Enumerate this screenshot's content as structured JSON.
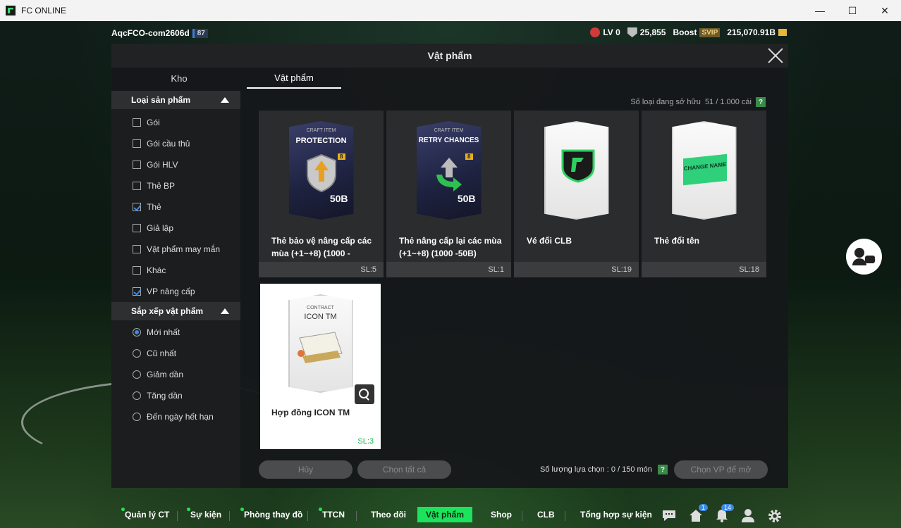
{
  "window": {
    "title": "FC ONLINE",
    "minimize": "—",
    "maximize": "☐",
    "close": "✕"
  },
  "hud": {
    "username": "AqcFCO-com2606d",
    "level": "87",
    "lv": "LV 0",
    "points": "25,855",
    "boost_label": "Boost",
    "svip": "SVIP",
    "balance": "215,070.91B"
  },
  "dialog": {
    "title": "Vật phẩm",
    "tabs": [
      "Kho",
      "Vật phẩm"
    ],
    "owned_label": "Số loại đang sở hữu",
    "owned_value": "51 / 1.000 cái",
    "help": "?",
    "product_section": "Loại sản phẩm",
    "product_types": [
      {
        "label": "Gói",
        "checked": false
      },
      {
        "label": "Gói cầu thủ",
        "checked": false
      },
      {
        "label": "Gói HLV",
        "checked": false
      },
      {
        "label": "Thẻ BP",
        "checked": false
      },
      {
        "label": "Thẻ",
        "checked": true
      },
      {
        "label": "Giả lập",
        "checked": false
      },
      {
        "label": "Vật phẩm may mắn",
        "checked": false
      },
      {
        "label": "Khác",
        "checked": false
      },
      {
        "label": "VP nâng cấp",
        "checked": true
      }
    ],
    "sort_section": "Sắp xếp vật phẩm",
    "sort_options": [
      {
        "label": "Mới nhất",
        "selected": true
      },
      {
        "label": "Cũ nhất",
        "selected": false
      },
      {
        "label": "Giảm dần",
        "selected": false
      },
      {
        "label": "Tăng dần",
        "selected": false
      },
      {
        "label": "Đến ngày hết hạn",
        "selected": false
      }
    ],
    "items": [
      {
        "name": "Thẻ bảo vệ nâng cấp các mùa (+1~+8) (1000 -",
        "qty": "SL:5",
        "art_top": "CRAFT ITEM",
        "art_name": "PROTECTION",
        "art_value": "50B",
        "art_grade": "8"
      },
      {
        "name": "Thẻ nâng cấp lại các mùa (+1~+8) (1000 -50B)",
        "qty": "SL:1",
        "art_top": "CRAFT ITEM",
        "art_name": "RETRY CHANCES",
        "art_value": "50B",
        "art_grade": "8"
      },
      {
        "name": "Vé đổi CLB",
        "qty": "SL:19"
      },
      {
        "name": "Thẻ đổi tên",
        "qty": "SL:18",
        "art_text": "CHANGE NAME"
      },
      {
        "name": "Hợp đồng ICON TM",
        "qty": "SL:3",
        "art_top": "CONTRACT",
        "art_name": "ICON TM"
      }
    ],
    "cancel_label": "Hủy",
    "select_all_label": "Chọn tất cả",
    "selection_label": "Số lượng lựa chọn : 0 / 150 món",
    "open_label": "Chọn VP để mở"
  },
  "nav": {
    "items": [
      "Quản lý CT",
      "Sự kiện",
      "Phòng thay đồ",
      "TTCN",
      "Theo dõi",
      "Vật phẩm",
      "Shop",
      "CLB",
      "Tổng hợp sự kiện"
    ],
    "home_badge": "1",
    "bell_badge": "14"
  },
  "colors": {
    "accent": "#1be35c",
    "check": "#3d8ae8",
    "qty_selected": "#16b84a"
  }
}
